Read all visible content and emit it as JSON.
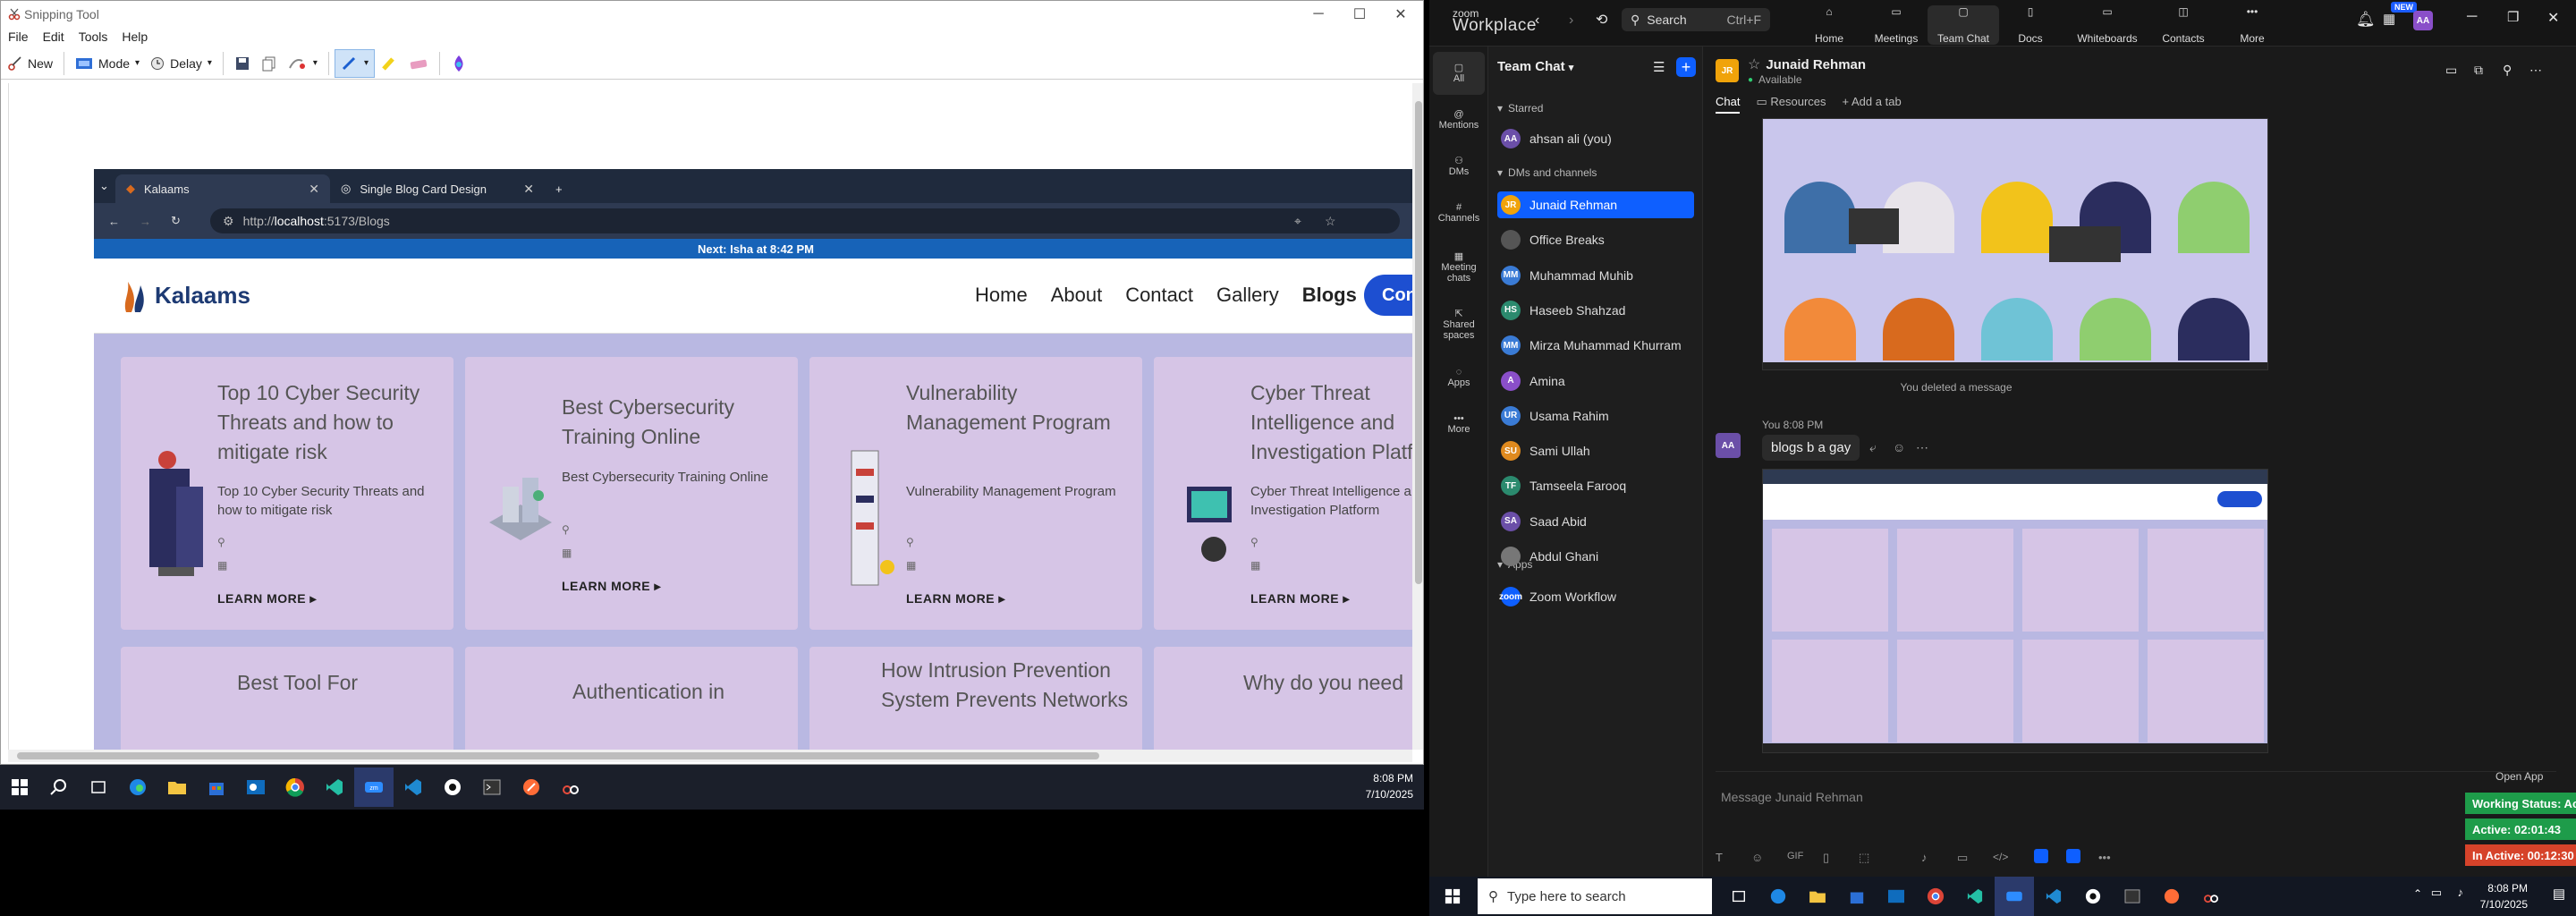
{
  "snip": {
    "title": "Snipping Tool",
    "menu": [
      "File",
      "Edit",
      "Tools",
      "Help"
    ],
    "toolbar": {
      "new": "New",
      "mode": "Mode",
      "delay": "Delay"
    },
    "browser": {
      "tabs": [
        {
          "label": "Kalaams"
        },
        {
          "label": "Single Blog Card Design"
        }
      ],
      "url_prefix": "http://",
      "url_host": "localhost",
      "url_path": ":5173/Blogs",
      "banner": "Next: Isha at 8:42 PM",
      "logo": "Kalaams",
      "nav": [
        "Home",
        "About",
        "Contact",
        "Gallery",
        "Blogs"
      ],
      "cta": "Con",
      "cards": [
        {
          "title": "Top 10 Cyber Security Threats and how to mitigate risk",
          "desc": "Top 10 Cyber Security Threats and how to mitigate risk",
          "more": "LEARN MORE ▸"
        },
        {
          "title": "Best Cybersecurity Training Online",
          "desc": "Best Cybersecurity Training Online",
          "more": "LEARN MORE ▸"
        },
        {
          "title": "Vulnerability Management Program",
          "desc": "Vulnerability Management Program",
          "more": "LEARN MORE ▸"
        },
        {
          "title": "Cyber Threat Intelligence and Investigation Platfo",
          "desc": "Cyber Threat Intelligence a Investigation Platform",
          "more": "LEARN MORE ▸"
        }
      ],
      "cards2": [
        {
          "title": "Best Tool For"
        },
        {
          "title": "Authentication in"
        },
        {
          "title": "How Intrusion Prevention System Prevents Networks"
        },
        {
          "title": "Why do you need"
        }
      ],
      "more_partial": "LEARN MORE"
    }
  },
  "taskbar_left": {
    "time": "8:08 PM",
    "date": "7/10/2025"
  },
  "zoom": {
    "brand_top": "zoom",
    "brand": "Workplace",
    "search": "Search",
    "search_shortcut": "Ctrl+F",
    "new_badge": "NEW",
    "tabs": [
      "Home",
      "Meetings",
      "Team Chat",
      "Docs",
      "Whiteboards",
      "Contacts",
      "More"
    ],
    "user_initials": "AA",
    "rail": [
      "All",
      "Mentions",
      "DMs",
      "Channels",
      "Meeting chats",
      "Shared spaces",
      "Apps",
      "More"
    ],
    "list_title": "Team Chat",
    "starred": "Starred",
    "dms_section": "DMs and channels",
    "apps_section": "Apps",
    "starred_items": [
      {
        "name": "ahsan ali (you)",
        "initials": "AA",
        "color": "#6b4fa8"
      }
    ],
    "dms": [
      {
        "name": "Junaid Rehman",
        "initials": "JR",
        "color": "#f0a30a"
      },
      {
        "name": "Office Breaks",
        "initials": "",
        "color": "#555555"
      },
      {
        "name": "Muhammad Muhib",
        "initials": "MM",
        "color": "#3a7bd5"
      },
      {
        "name": "Haseeb Shahzad",
        "initials": "HS",
        "color": "#2b8a6e"
      },
      {
        "name": "Mirza Muhammad Khurram",
        "initials": "MM",
        "color": "#3a7bd5"
      },
      {
        "name": "Amina",
        "initials": "A",
        "color": "#8a4fc9"
      },
      {
        "name": "Usama Rahim",
        "initials": "UR",
        "color": "#3a7bd5"
      },
      {
        "name": "Sami Ullah",
        "initials": "SU",
        "color": "#e08a1e"
      },
      {
        "name": "Tamseela Farooq",
        "initials": "TF",
        "color": "#2b8a6e"
      },
      {
        "name": "Saad Abid",
        "initials": "SA",
        "color": "#6b4fa8"
      },
      {
        "name": "Abdul Ghani",
        "initials": "",
        "color": "#777777"
      }
    ],
    "apps": [
      {
        "name": "Zoom Workflow",
        "initials": "zoom",
        "color": "#0e5fff"
      }
    ],
    "chat": {
      "name": "Junaid Rehman",
      "initials": "JR",
      "status": "Available",
      "tabs": [
        "Chat",
        "Resources",
        "Add a tab"
      ],
      "deleted": "You deleted a message",
      "sender": "You 8:08 PM",
      "message": "blogs b a gay",
      "compose": "Message Junaid Rehman",
      "open_app": "Open App"
    },
    "status_widget": [
      {
        "label": "Working Status: Active",
        "color": "#1e9c4a"
      },
      {
        "label": "Active: 02:01:43",
        "color": "#1e9c4a"
      },
      {
        "label": "In Active: 00:12:30",
        "color": "#d6432a"
      }
    ]
  },
  "taskbar_right": {
    "search": "Type here to search",
    "time": "8:08 PM",
    "date": "7/10/2025"
  }
}
